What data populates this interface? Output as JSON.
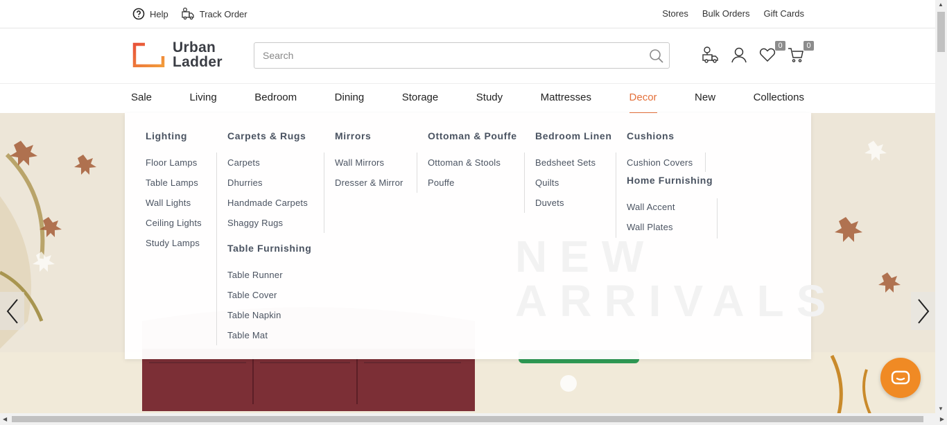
{
  "util_bar": {
    "left": [
      {
        "label": "Help",
        "icon": "help-circle-icon"
      },
      {
        "label": "Track Order",
        "icon": "delivery-truck-icon"
      }
    ],
    "right": [
      "Stores",
      "Bulk Orders",
      "Gift Cards"
    ]
  },
  "header": {
    "logo_line1": "Urban",
    "logo_line2": "Ladder",
    "brand_color": "#e4703a",
    "search": {
      "placeholder": "Search",
      "value": ""
    },
    "wishlist_count": "0",
    "cart_count": "0"
  },
  "catnav": {
    "items": [
      "Sale",
      "Living",
      "Bedroom",
      "Dining",
      "Storage",
      "Study",
      "Mattresses",
      "Decor",
      "New",
      "Collections"
    ],
    "active": "Decor",
    "active_color": "#e4703a"
  },
  "mega_menu": {
    "lighting": {
      "title": "Lighting",
      "links": [
        "Floor Lamps",
        "Table Lamps",
        "Wall Lights",
        "Ceiling Lights",
        "Study Lamps"
      ]
    },
    "carpets": {
      "title": "Carpets & Rugs",
      "links": [
        "Carpets",
        "Dhurries",
        "Handmade Carpets",
        "Shaggy Rugs"
      ]
    },
    "table_furnishing": {
      "title": "Table Furnishing",
      "links": [
        "Table Runner",
        "Table Cover",
        "Table Napkin",
        "Table Mat"
      ]
    },
    "mirrors": {
      "title": "Mirrors",
      "links": [
        "Wall Mirrors",
        "Dresser & Mirror"
      ]
    },
    "ottoman": {
      "title": "Ottoman & Pouffe",
      "links": [
        "Ottoman & Stools",
        "Pouffe"
      ]
    },
    "bedroom_linen": {
      "title": "Bedroom Linen",
      "links": [
        "Bedsheet Sets",
        "Quilts",
        "Duvets"
      ]
    },
    "cushions": {
      "title": "Cushions",
      "links": [
        "Cushion Covers"
      ]
    },
    "home_furnishing": {
      "title": "Home Furnishing",
      "links": [
        "Wall Accent",
        "Wall Plates"
      ]
    }
  },
  "hero": {
    "headline_line1": "NEW",
    "headline_line2": "ARRIVALS"
  }
}
